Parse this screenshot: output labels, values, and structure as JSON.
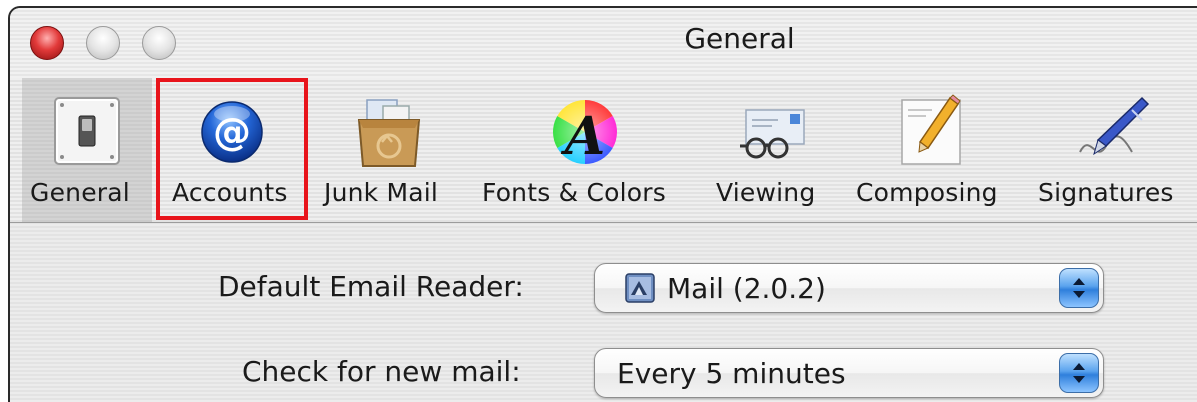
{
  "window": {
    "title": "General"
  },
  "toolbar": {
    "items": [
      {
        "label": "General",
        "icon": "light-switch-icon"
      },
      {
        "label": "Accounts",
        "icon": "at-sign-icon"
      },
      {
        "label": "Junk Mail",
        "icon": "junk-mail-box-icon"
      },
      {
        "label": "Fonts & Colors",
        "icon": "fonts-colors-icon"
      },
      {
        "label": "Viewing",
        "icon": "viewing-glasses-icon"
      },
      {
        "label": "Composing",
        "icon": "composing-pencil-icon"
      },
      {
        "label": "Signatures",
        "icon": "signature-pen-icon"
      }
    ],
    "selected": "General",
    "highlighted": "Accounts",
    "highlight_color": "#e8141b"
  },
  "settings": {
    "default_reader_label": "Default Email Reader:",
    "default_reader_value": "Mail (2.0.2)",
    "check_mail_label": "Check for new mail:",
    "check_mail_value": "Every 5 minutes"
  }
}
